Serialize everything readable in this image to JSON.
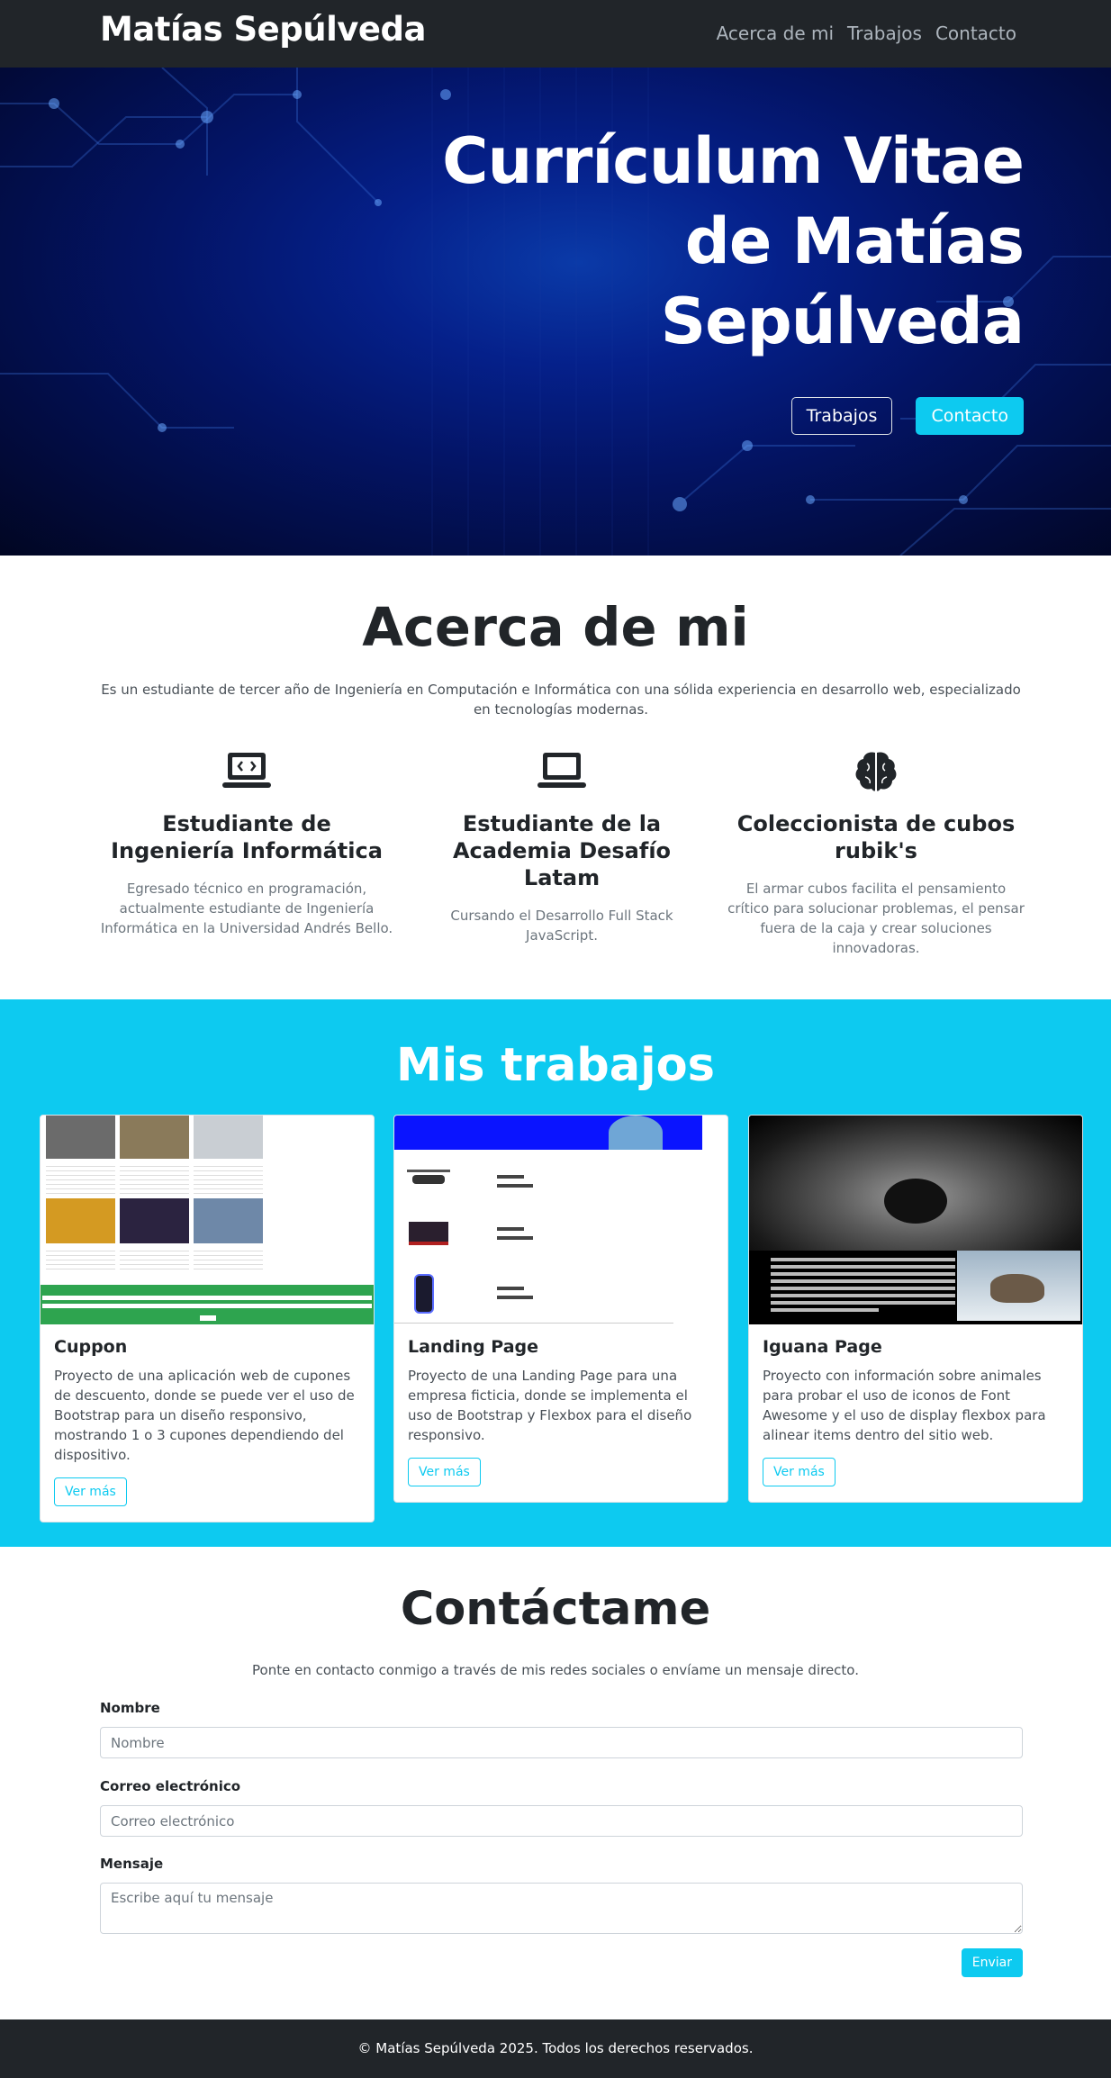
{
  "navbar": {
    "brand": "Matías Sepúlveda",
    "links": [
      "Acerca de mi",
      "Trabajos",
      "Contacto"
    ]
  },
  "hero": {
    "title_lines": [
      "Currículum Vitae",
      "de Matías",
      "Sepúlveda"
    ],
    "btn_trabajos": "Trabajos",
    "btn_contacto": "Contacto"
  },
  "about": {
    "title": "Acerca de mi",
    "lead": "Es un estudiante de tercer año de Ingeniería en Computación e Informática con una sólida experiencia en desarrollo web, especializado en tecnologías modernas.",
    "features": [
      {
        "icon": "laptop-code-icon",
        "title": "Estudiante de Ingeniería Informática",
        "text": "Egresado técnico en programación, actualmente estudiante de Ingeniería Informática en la Universidad Andrés Bello."
      },
      {
        "icon": "laptop-icon",
        "title": "Estudiante de la Academia Desafío Latam",
        "text": "Cursando el Desarrollo Full Stack JavaScript."
      },
      {
        "icon": "brain-icon",
        "title": "Coleccionista de cubos rubik's",
        "text": "El armar cubos facilita el pensamiento crítico para solucionar problemas, el pensar fuera de la caja y crear soluciones innovadoras."
      }
    ]
  },
  "works": {
    "title": "Mis trabajos",
    "cards": [
      {
        "title": "Cuppon",
        "text": "Proyecto de una aplicación web de cupones de descuento, donde se puede ver el uso de Bootstrap para un diseño responsivo, mostrando 1 o 3 cupones dependiendo del dispositivo.",
        "button": "Ver más"
      },
      {
        "title": "Landing Page",
        "text": "Proyecto de una Landing Page para una empresa ficticia, donde se implementa el uso de Bootstrap y Flexbox para el diseño responsivo.",
        "button": "Ver más"
      },
      {
        "title": "Iguana Page",
        "text": "Proyecto con información sobre animales para probar el uso de iconos de Font Awesome y el uso de display flexbox para alinear items dentro del sitio web.",
        "button": "Ver más"
      }
    ]
  },
  "contact": {
    "title": "Contáctame",
    "lead": "Ponte en contacto conmigo a través de mis redes sociales o envíame un mensaje directo.",
    "name_label": "Nombre",
    "name_placeholder": "Nombre",
    "email_label": "Correo electrónico",
    "email_placeholder": "Correo electrónico",
    "message_label": "Mensaje",
    "message_placeholder": "Escribe aquí tu mensaje",
    "submit": "Enviar"
  },
  "footer": {
    "text": "© Matías Sepúlveda 2025. Todos los derechos reservados."
  },
  "colors": {
    "navbar": "#212529",
    "accent": "#0dcaf0",
    "hero_dark": "#020b3d",
    "hero_glow": "#0a3aa8"
  }
}
